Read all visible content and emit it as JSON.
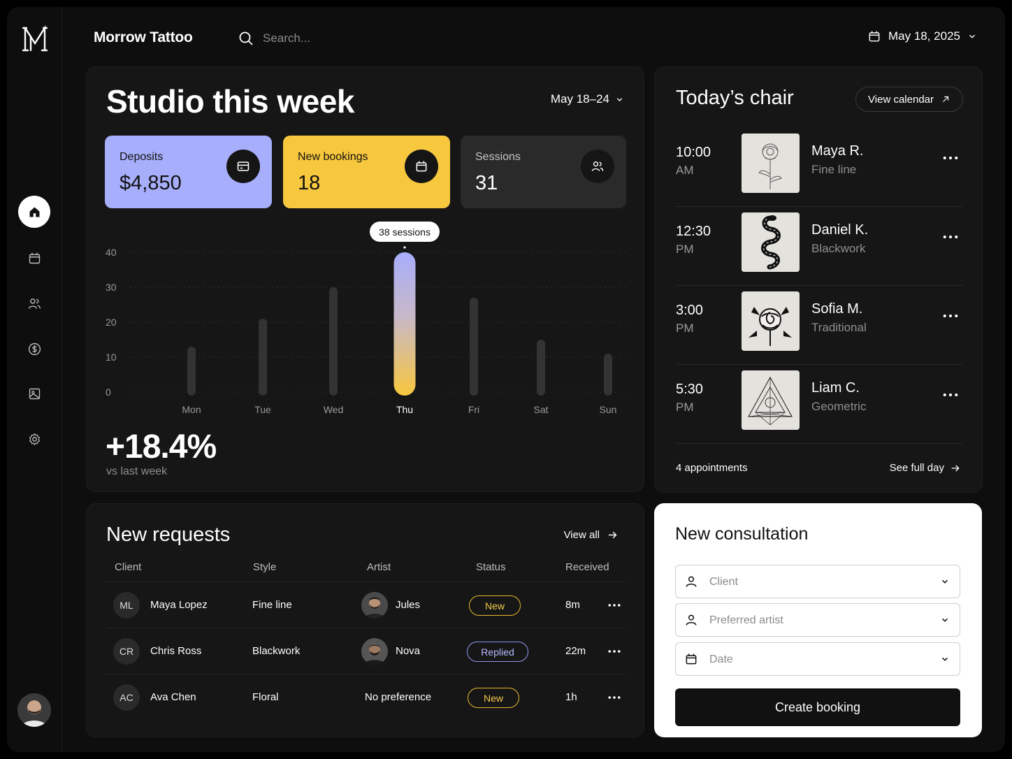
{
  "app": {
    "brand": "Morrow Tattoo",
    "logo_letter": "M"
  },
  "header": {
    "search_placeholder": "Search...",
    "date": "May 18, 2025"
  },
  "sidebar": {
    "items": [
      {
        "name": "home",
        "icon": "home-icon",
        "active": true
      },
      {
        "name": "calendar",
        "icon": "calendar-icon",
        "active": false
      },
      {
        "name": "clients",
        "icon": "users-icon",
        "active": false
      },
      {
        "name": "payments",
        "icon": "dollar-icon",
        "active": false
      },
      {
        "name": "gallery",
        "icon": "image-icon",
        "active": false
      },
      {
        "name": "settings",
        "icon": "gear-icon",
        "active": false
      }
    ]
  },
  "studio": {
    "title": "Studio this week",
    "range": "May 18–24",
    "stats": [
      {
        "label": "Deposits",
        "value": "$4,850",
        "icon": "card-icon",
        "color": "#a7aefb"
      },
      {
        "label": "New bookings",
        "value": "18",
        "icon": "calendar-icon",
        "color": "#f7c73d"
      },
      {
        "label": "Sessions",
        "value": "31",
        "icon": "users-icon",
        "color": "#2a2a2a"
      }
    ],
    "growth": "+18.4%",
    "growth_sub": "vs last week"
  },
  "chart_data": {
    "type": "bar",
    "categories": [
      "Mon",
      "Tue",
      "Wed",
      "Thu",
      "Fri",
      "Sat",
      "Sun"
    ],
    "values": [
      13,
      21,
      30,
      40,
      27,
      15,
      11
    ],
    "highlight_index": 3,
    "tooltip": "38 sessions",
    "yticks": [
      0,
      10,
      20,
      30,
      40
    ],
    "ylim": [
      0,
      40
    ],
    "grid": true
  },
  "chair": {
    "title": "Today’s chair",
    "view_calendar": "View calendar",
    "appointments": [
      {
        "time": "10:00",
        "ampm": "AM",
        "name": "Maya R.",
        "style": "Fine line",
        "art": "flower"
      },
      {
        "time": "12:30",
        "ampm": "PM",
        "name": "Daniel K.",
        "style": "Blackwork",
        "art": "snake"
      },
      {
        "time": "3:00",
        "ampm": "PM",
        "name": "Sofia M.",
        "style": "Traditional",
        "art": "rose"
      },
      {
        "time": "5:30",
        "ampm": "PM",
        "name": "Liam C.",
        "style": "Geometric",
        "art": "triangle"
      }
    ],
    "count": "4 appointments",
    "see_full": "See full day"
  },
  "requests": {
    "title": "New requests",
    "view_all": "View all",
    "columns": [
      "Client",
      "Style",
      "Artist",
      "Status",
      "Received"
    ],
    "rows": [
      {
        "initials": "ML",
        "client": "Maya Lopez",
        "style": "Fine line",
        "artist": "Jules",
        "has_avatar": true,
        "status": "New",
        "status_kind": "new",
        "received": "8m"
      },
      {
        "initials": "CR",
        "client": "Chris Ross",
        "style": "Blackwork",
        "artist": "Nova",
        "has_avatar": true,
        "status": "Replied",
        "status_kind": "replied",
        "received": "22m"
      },
      {
        "initials": "AC",
        "client": "Ava Chen",
        "style": "Floral",
        "artist": "No preference",
        "has_avatar": false,
        "status": "New",
        "status_kind": "new",
        "received": "1h"
      }
    ]
  },
  "consultation": {
    "title": "New consultation",
    "client_placeholder": "Client",
    "artist_placeholder": "Preferred artist",
    "date_placeholder": "Date",
    "submit": "Create booking"
  }
}
